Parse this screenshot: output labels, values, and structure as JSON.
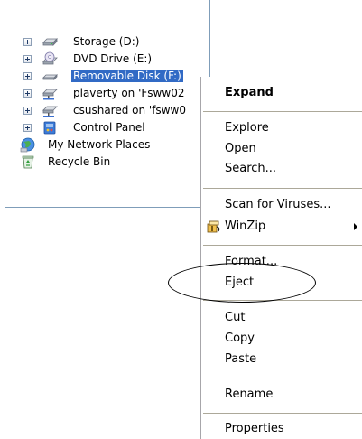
{
  "tree": {
    "items": [
      {
        "label": "Storage (D:)",
        "icon": "hard-drive-icon",
        "expander": true,
        "selected": false
      },
      {
        "label": "DVD Drive (E:)",
        "icon": "dvd-drive-icon",
        "expander": true,
        "selected": false
      },
      {
        "label": "Removable Disk (F:)",
        "icon": "removable-disk-icon",
        "expander": true,
        "selected": true
      },
      {
        "label": "plaverty on 'Fsww02",
        "icon": "network-drive-icon",
        "expander": true,
        "selected": false
      },
      {
        "label": "csushared on 'fsww0",
        "icon": "network-drive-icon",
        "expander": true,
        "selected": false
      },
      {
        "label": "Control Panel",
        "icon": "control-panel-icon",
        "expander": true,
        "selected": false
      },
      {
        "label": "My Network Places",
        "icon": "network-places-icon",
        "expander": false,
        "selected": false
      },
      {
        "label": "Recycle Bin",
        "icon": "recycle-bin-icon",
        "expander": false,
        "selected": false
      }
    ]
  },
  "context_menu": {
    "expand": "Expand",
    "explore": "Explore",
    "open": "Open",
    "search": "Search...",
    "scan": "Scan for Viruses...",
    "winzip": "WinZip",
    "format": "Format...",
    "eject": "Eject",
    "cut": "Cut",
    "copy": "Copy",
    "paste": "Paste",
    "rename": "Rename",
    "properties": "Properties"
  },
  "colors": {
    "selection": "#316ac5",
    "annotation": "#000000"
  }
}
